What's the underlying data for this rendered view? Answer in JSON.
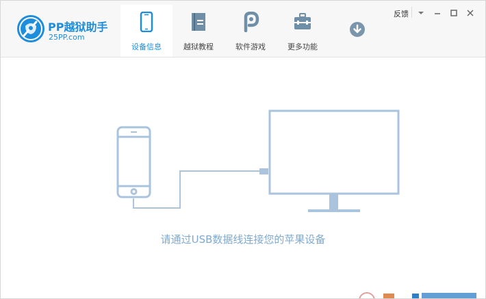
{
  "app": {
    "title": "PP越狱助手",
    "url": "25PP.com"
  },
  "colors": {
    "brand": "#1d8ddc",
    "illustration": "#aac4dd",
    "prompt": "#7fa9cf"
  },
  "tabs": [
    {
      "label": "设备信息",
      "icon": "phone-icon",
      "active": true
    },
    {
      "label": "越狱教程",
      "icon": "book-icon",
      "active": false
    },
    {
      "label": "软件游戏",
      "icon": "pp-app-icon",
      "active": false
    },
    {
      "label": "更多功能",
      "icon": "toolbox-icon",
      "active": false
    }
  ],
  "toolbar": {
    "download_icon": "download-icon"
  },
  "window_controls": {
    "feedback_label": "反馈",
    "menu_icon": "dropdown-icon",
    "minimize_icon": "minimize-icon",
    "maximize_icon": "maximize-icon",
    "close_icon": "close-icon"
  },
  "main": {
    "prompt": "请通过USB数据线连接您的苹果设备"
  }
}
